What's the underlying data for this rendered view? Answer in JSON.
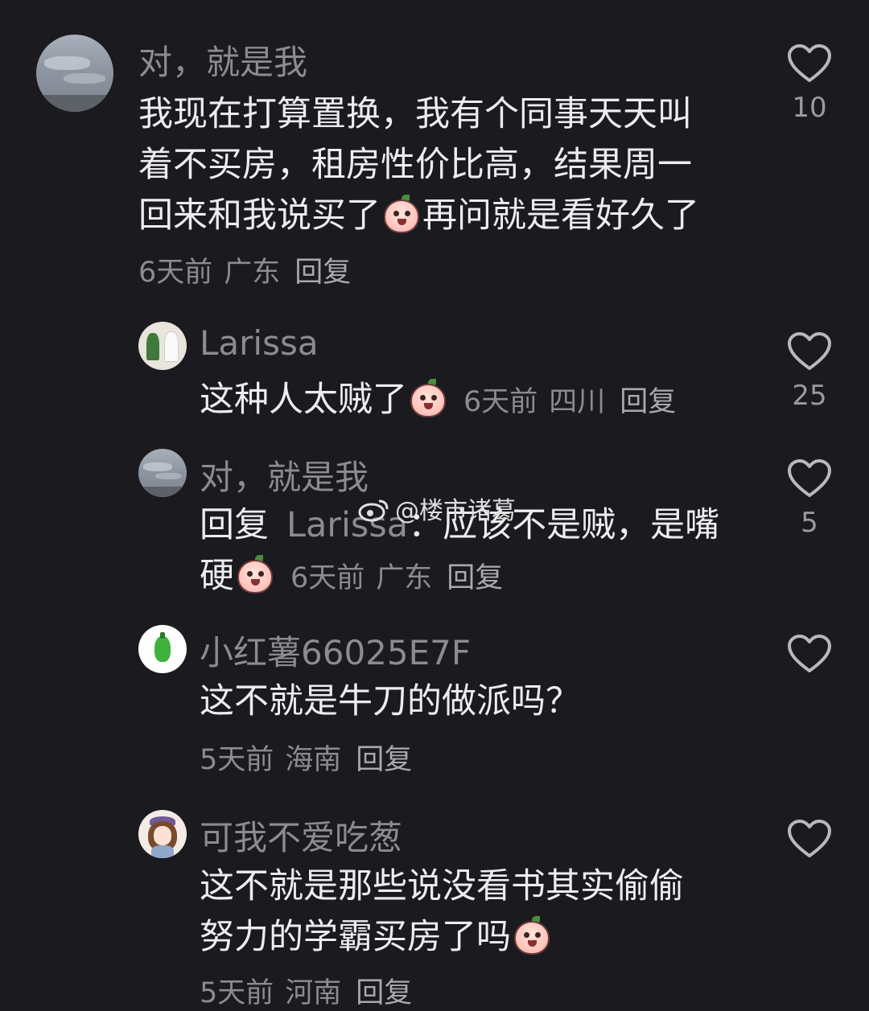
{
  "comments": [
    {
      "username": "对，就是我",
      "lines": [
        "我现在打算置换，我有个同事天天叫",
        "着不买房，租房性价比高，结果周一",
        "回来和我说买了",
        "再问就是看好久了"
      ],
      "time": "6天前",
      "location": "广东",
      "reply_label": "回复",
      "likes": "10"
    },
    {
      "username": "Larissa",
      "text": "这种人太贼了",
      "time": "6天前",
      "location": "四川",
      "reply_label": "回复",
      "likes": "25"
    },
    {
      "username": "对，就是我",
      "reply_prefix": "回复",
      "reply_to": "Larissa",
      "line1_rest": "：应该不是贼，是嘴",
      "line2": "硬",
      "time": "6天前",
      "location": "广东",
      "reply_label": "回复",
      "likes": "5"
    },
    {
      "username": "小红薯66025E7F",
      "text": "这不就是牛刀的做派吗？",
      "time": "5天前",
      "location": "海南",
      "reply_label": "回复",
      "likes": ""
    },
    {
      "username": "可我不爱吃葱",
      "lines": [
        "这不就是那些说没看书其实偷偷",
        "努力的学霸买房了吗"
      ],
      "time": "5天前",
      "location": "河南",
      "reply_label": "回复",
      "likes": ""
    }
  ],
  "watermark": "@楼市诸葛",
  "icons": {
    "like": "heart-outline-icon",
    "emoji": "peach-face-emoji-icon"
  },
  "colors": {
    "background": "#1a1a1f",
    "username": "#8b8b90",
    "text": "#ededf0"
  }
}
